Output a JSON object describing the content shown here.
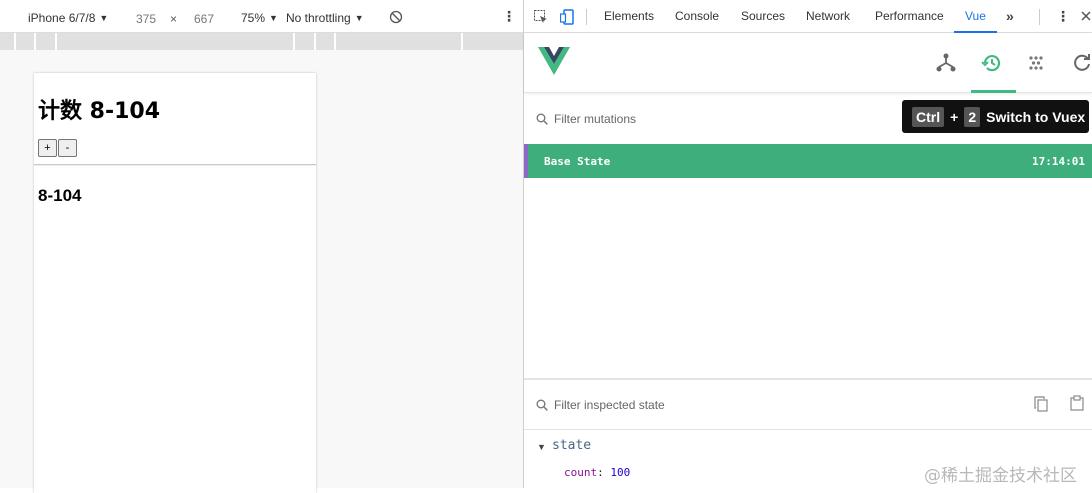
{
  "device_toolbar": {
    "device": "iPhone 6/7/8",
    "width": "375",
    "times": "×",
    "height": "667",
    "zoom": "75%",
    "throttle": "No throttling"
  },
  "page": {
    "title": "计数 8-104",
    "increment": "+",
    "decrement": "-",
    "value": "8-104"
  },
  "devtools": {
    "tabs": [
      "Elements",
      "Console",
      "Sources",
      "Network",
      "Performance",
      "Vue"
    ],
    "active_tab": "Vue",
    "more": "»"
  },
  "vue": {
    "tooltip": {
      "key1": "Ctrl",
      "plus": "+",
      "key2": "2",
      "text": "Switch to Vuex"
    },
    "filter_mutations_placeholder": "Filter mutations",
    "mutations": [
      {
        "name": "Base State",
        "time": "17:14:01"
      }
    ],
    "filter_state_placeholder": "Filter inspected state",
    "state_label": "state",
    "state": {
      "key": "count",
      "value": "100"
    },
    "accent": "#42b983"
  },
  "watermark": "@稀土掘金技术社区"
}
